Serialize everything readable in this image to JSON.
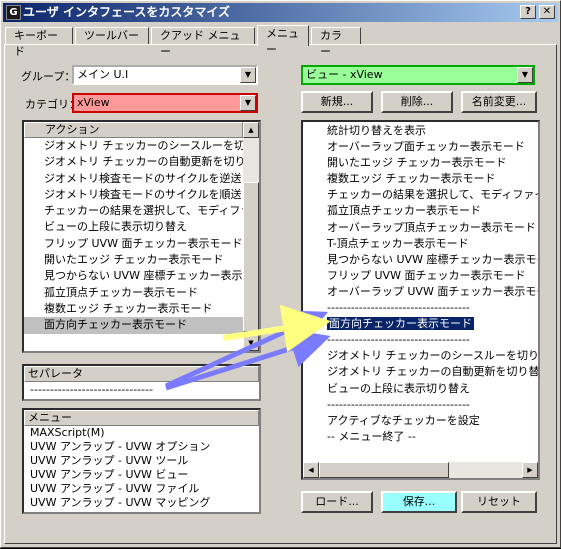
{
  "window": {
    "title": "ユーザ インタフェースをカスタマイズ",
    "help_btn": "?",
    "close_btn": "✕"
  },
  "tabs": [
    "キーボード",
    "ツールバー",
    "クアッド メニュー",
    "メニュー",
    "カラー"
  ],
  "group": {
    "label": "グループ：",
    "value": "メイン U.I"
  },
  "category": {
    "label": "カテゴリ：",
    "value": "xView"
  },
  "actions": {
    "header": "アクション",
    "items": [
      "ジオメトリ チェッカーのシースルーを切り…",
      "ジオメトリ チェッカーの自動更新を切り…",
      "ジオメトリ検査モードのサイクルを逆送り",
      "ジオメトリ検査モードのサイクルを順送り",
      "チェッカーの結果を選択して、モディファ…",
      "ビューの上段に表示切り替え",
      "フリップ UVW 面チェッカー表示モード",
      "開いたエッジ チェッカー表示モード",
      "見つからない UVW 座標チェッカー表示…",
      "孤立頂点チェッカー表示モード",
      "複数エッジ チェッカー表示モード",
      "面方向チェッカー表示モード"
    ]
  },
  "separator": {
    "header": "セパレータ",
    "item": "-------------------------------"
  },
  "menus": {
    "header": "メニュー",
    "items": [
      "MAXScript(M)",
      "UVW アンラップ - UVW オプション",
      "UVW アンラップ - UVW ツール",
      "UVW アンラップ - UVW ビュー",
      "UVW アンラップ - UVW ファイル",
      "UVW アンラップ - UVW マッピング"
    ]
  },
  "right": {
    "menu_select": "ビュー - xView",
    "new_btn": "新規...",
    "delete_btn": "削除...",
    "rename_btn": "名前変更...",
    "items": [
      "統計切り替えを表示",
      "オーバーラップ面チェッカー表示モード",
      "開いたエッジ チェッカー表示モード",
      "複数エッジ チェッカー表示モード",
      "チェッカーの結果を選択して、モディファイヤ ス",
      "孤立頂点チェッカー表示モード",
      "オーバーラップ頂点チェッカー表示モード",
      "T-頂点チェッカー表示モード",
      "見つからない UVW 座標チェッカー表示モード",
      "フリップ UVW 面チェッカー表示モード",
      "オーバーラップ UVW 面チェッカー表示モード",
      "------------------------------------",
      "面方向チェッカー表示モード",
      "------------------------------------",
      "ジオメトリ チェッカーのシースルーを切り替え",
      "ジオメトリ チェッカーの自動更新を切り替え",
      "ビューの上段に表示切り替え",
      "------------------------------------",
      "アクティブなチェッカーを設定",
      "-- メニュー終了 --"
    ],
    "load_btn": "ロード...",
    "save_btn": "保存...",
    "reset_btn": "リセット"
  },
  "colors": {
    "category_bg": "#ff9999",
    "menu_select_bg": "#99ff99",
    "save_btn_bg": "#99ffff",
    "arrow": "#7b7bff",
    "arrow_yellow": "#ffff80",
    "selection": "#0a246a"
  }
}
